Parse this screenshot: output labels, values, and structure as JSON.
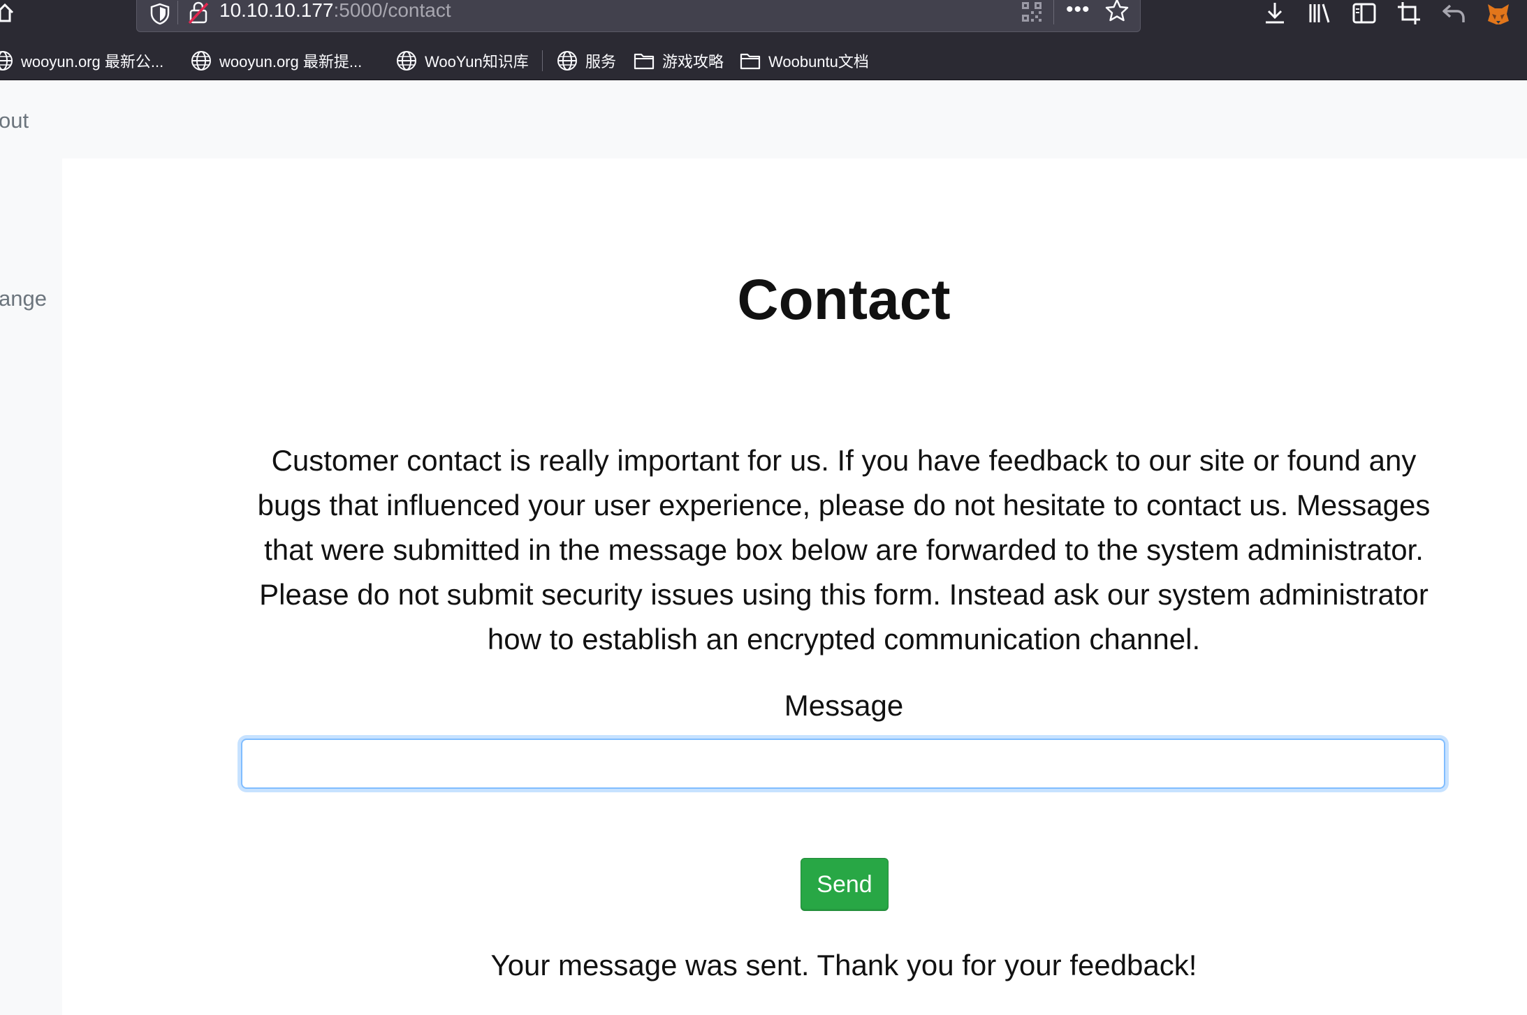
{
  "browser": {
    "url_host": "10.10.10.177",
    "url_path": ":5000/contact",
    "bookmarks": [
      {
        "label": "wooyun.org 最新公...",
        "icon": "globe-icon"
      },
      {
        "label": "wooyun.org 最新提...",
        "icon": "globe-icon"
      },
      {
        "label": "WooYun知识库",
        "icon": "globe-icon"
      },
      {
        "label": "服务",
        "icon": "globe-icon"
      },
      {
        "label": "游戏攻略",
        "icon": "folder-icon"
      },
      {
        "label": "Woobuntu文档",
        "icon": "folder-icon"
      }
    ],
    "chrome_bg": "#2b2a33"
  },
  "nav": {
    "fragment_1": "out",
    "fragment_2": "ange"
  },
  "page": {
    "title": "Contact",
    "intro": "Customer contact is really important for us. If you have feedback to our site or found any bugs that influenced your user experience, please do not hesitate to contact us. Messages that were submitted in the message box below are forwarded to the system administrator. Please do not submit security issues using this form. Instead ask our system administrator how to establish an encrypted communication channel.",
    "message_label": "Message",
    "message_value": "",
    "send_label": "Send",
    "status": "Your message was sent. Thank you for your feedback!"
  },
  "colors": {
    "send_button": "#28a745",
    "input_focus": "#80bdff"
  }
}
